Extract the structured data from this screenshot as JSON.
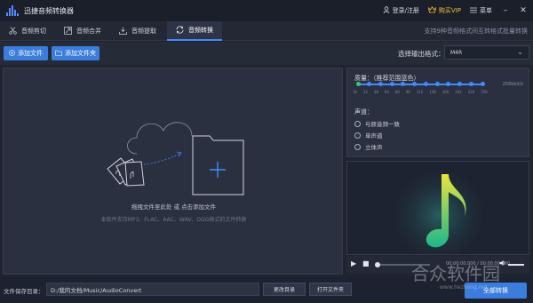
{
  "app": {
    "title": "迅捷音频转换器"
  },
  "titlebar": {
    "login": "登录/注册",
    "vip": "购买VIP",
    "menu": "菜单"
  },
  "tabs": [
    {
      "label": "音频剪切",
      "icon": "scissors-icon"
    },
    {
      "label": "音频合并",
      "icon": "merge-icon"
    },
    {
      "label": "音频提取",
      "icon": "extract-icon"
    },
    {
      "label": "音频转换",
      "icon": "convert-icon",
      "active": true
    }
  ],
  "slogan": "支持9种音频格式间互转格式批量转换",
  "toolbar": {
    "add_file": "添加文件",
    "add_folder": "添加文件夹",
    "format_label": "选择输出格式：",
    "format_value": "M4R"
  },
  "drop": {
    "hint_main": "拖拽文件至此处 或 点击添加文件",
    "hint_sub": "本软件支持MP3、FLAC、AAC、WAV、OGG格式的文件转换"
  },
  "quality": {
    "label": "质量：（推荐范围蓝色）",
    "bitrate": "256kbit/s",
    "ticks": [
      "16",
      "32",
      "48",
      "64",
      "80",
      "96",
      "112",
      "128",
      "160",
      "192",
      "224",
      "256"
    ],
    "selected_index": 11
  },
  "channel": {
    "label": "声道：",
    "options": [
      "与原音频一致",
      "单声道",
      "立体声"
    ]
  },
  "player": {
    "time": "00:00:00,000 / 00:00:00,000"
  },
  "bottom": {
    "save_label": "文件保存目录：",
    "path": "D:/我的文档/Music/AudioConvert",
    "change_dir": "更改目录",
    "open_folder": "打开文件夹",
    "convert_all": "全部转换"
  },
  "watermark": {
    "text": "合众软件园",
    "sub": "www.hezhong.net"
  },
  "colors": {
    "accent": "#3b7dde",
    "music_note": "#e8e040",
    "vip": "#f0c040"
  }
}
